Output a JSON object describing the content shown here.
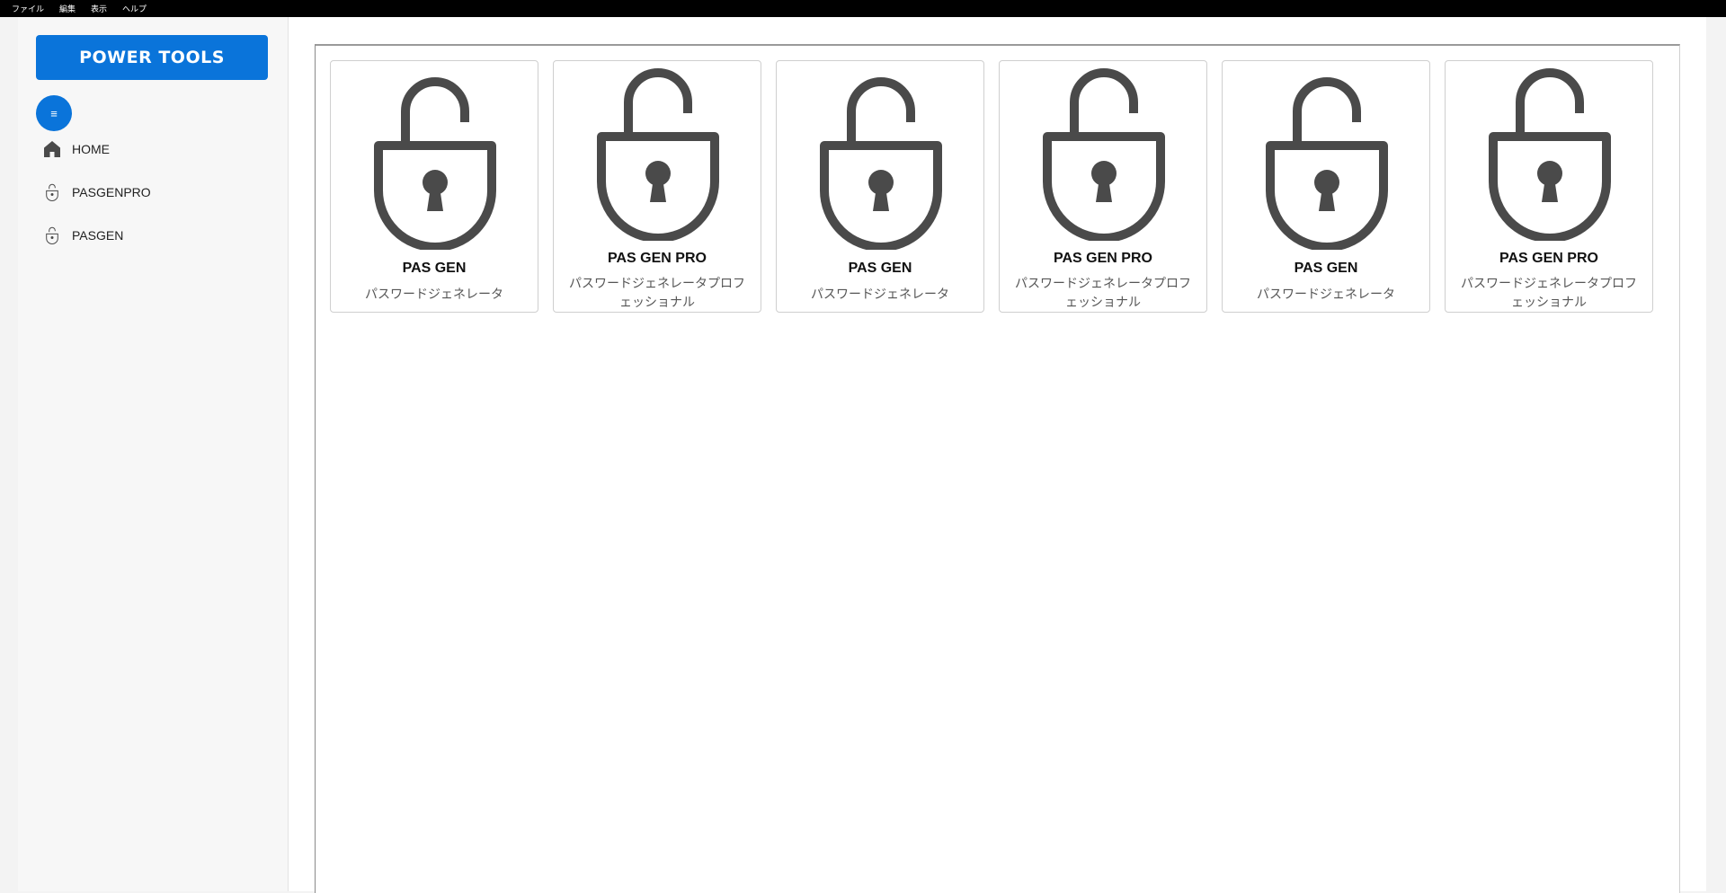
{
  "menubar": {
    "items": [
      {
        "label": "ファイル"
      },
      {
        "label": "編集"
      },
      {
        "label": "表示"
      },
      {
        "label": "ヘルプ"
      }
    ]
  },
  "sidebar": {
    "brand_label": "POWER TOOLS",
    "menu_toggle_glyph": "≡",
    "items": [
      {
        "label": "HOME",
        "icon": "home-icon"
      },
      {
        "label": "PASGENPRO",
        "icon": "unlock-icon"
      },
      {
        "label": "PASGEN",
        "icon": "unlock-icon"
      }
    ]
  },
  "main": {
    "cards": [
      {
        "title": "PAS GEN",
        "description": "パスワードジェネレータ",
        "icon": "unlock-icon"
      },
      {
        "title": "PAS GEN PRO",
        "description": "パスワードジェネレータプロフェッショナル",
        "icon": "unlock-icon"
      },
      {
        "title": "PAS GEN",
        "description": "パスワードジェネレータ",
        "icon": "unlock-icon"
      },
      {
        "title": "PAS GEN PRO",
        "description": "パスワードジェネレータプロフェッショナル",
        "icon": "unlock-icon"
      },
      {
        "title": "PAS GEN",
        "description": "パスワードジェネレータ",
        "icon": "unlock-icon"
      },
      {
        "title": "PAS GEN PRO",
        "description": "パスワードジェネレータプロフェッショナル",
        "icon": "unlock-icon"
      }
    ]
  },
  "colors": {
    "accent": "#0a74da",
    "icon": "#4a4a4a",
    "menubar": "#000000"
  }
}
